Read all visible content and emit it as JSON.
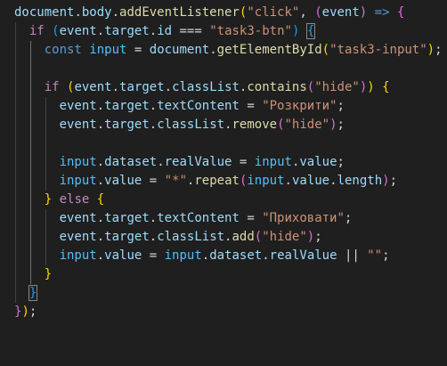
{
  "editor": {
    "language": "javascript",
    "lines": [
      [
        {
          "t": "document",
          "c": "c-var"
        },
        {
          "t": ".",
          "c": "c-op"
        },
        {
          "t": "body",
          "c": "c-var"
        },
        {
          "t": ".",
          "c": "c-op"
        },
        {
          "t": "addEventListener",
          "c": "c-fn"
        },
        {
          "t": "(",
          "c": "c-p1"
        },
        {
          "t": "\"click\"",
          "c": "c-str"
        },
        {
          "t": ", ",
          "c": "c-op"
        },
        {
          "t": "(",
          "c": "c-p2"
        },
        {
          "t": "event",
          "c": "c-var"
        },
        {
          "t": ")",
          "c": "c-p2"
        },
        {
          "t": " ",
          "c": "c-op"
        },
        {
          "t": "=>",
          "c": "c-decl"
        },
        {
          "t": " ",
          "c": "c-op"
        },
        {
          "t": "{",
          "c": "c-p2"
        }
      ],
      [
        {
          "t": "  ",
          "c": "c-op"
        },
        {
          "t": "if",
          "c": "c-kw"
        },
        {
          "t": " ",
          "c": "c-op"
        },
        {
          "t": "(",
          "c": "c-p3"
        },
        {
          "t": "event",
          "c": "c-var"
        },
        {
          "t": ".",
          "c": "c-op"
        },
        {
          "t": "target",
          "c": "c-var"
        },
        {
          "t": ".",
          "c": "c-op"
        },
        {
          "t": "id",
          "c": "c-var"
        },
        {
          "t": " === ",
          "c": "c-op"
        },
        {
          "t": "\"task3-btn\"",
          "c": "c-str"
        },
        {
          "t": ")",
          "c": "c-p3"
        },
        {
          "t": " ",
          "c": "c-op"
        },
        {
          "t": "{",
          "c": "c-p3",
          "m": true
        }
      ],
      [
        {
          "t": "    ",
          "c": "c-op"
        },
        {
          "t": "const",
          "c": "c-decl"
        },
        {
          "t": " ",
          "c": "c-op"
        },
        {
          "t": "input",
          "c": "c-const"
        },
        {
          "t": " = ",
          "c": "c-op"
        },
        {
          "t": "document",
          "c": "c-var"
        },
        {
          "t": ".",
          "c": "c-op"
        },
        {
          "t": "getElementById",
          "c": "c-fn"
        },
        {
          "t": "(",
          "c": "c-p1"
        },
        {
          "t": "\"task3-input\"",
          "c": "c-str"
        },
        {
          "t": ")",
          "c": "c-p1"
        },
        {
          "t": ";",
          "c": "c-op"
        }
      ],
      [],
      [
        {
          "t": "    ",
          "c": "c-op"
        },
        {
          "t": "if",
          "c": "c-kw"
        },
        {
          "t": " ",
          "c": "c-op"
        },
        {
          "t": "(",
          "c": "c-p1"
        },
        {
          "t": "event",
          "c": "c-var"
        },
        {
          "t": ".",
          "c": "c-op"
        },
        {
          "t": "target",
          "c": "c-var"
        },
        {
          "t": ".",
          "c": "c-op"
        },
        {
          "t": "classList",
          "c": "c-var"
        },
        {
          "t": ".",
          "c": "c-op"
        },
        {
          "t": "contains",
          "c": "c-fn"
        },
        {
          "t": "(",
          "c": "c-p2"
        },
        {
          "t": "\"hide\"",
          "c": "c-str"
        },
        {
          "t": ")",
          "c": "c-p2"
        },
        {
          "t": ")",
          "c": "c-p1"
        },
        {
          "t": " ",
          "c": "c-op"
        },
        {
          "t": "{",
          "c": "c-p1"
        }
      ],
      [
        {
          "t": "      ",
          "c": "c-op"
        },
        {
          "t": "event",
          "c": "c-var"
        },
        {
          "t": ".",
          "c": "c-op"
        },
        {
          "t": "target",
          "c": "c-var"
        },
        {
          "t": ".",
          "c": "c-op"
        },
        {
          "t": "textContent",
          "c": "c-var"
        },
        {
          "t": " = ",
          "c": "c-op"
        },
        {
          "t": "\"Розкрити\"",
          "c": "c-str"
        },
        {
          "t": ";",
          "c": "c-op"
        }
      ],
      [
        {
          "t": "      ",
          "c": "c-op"
        },
        {
          "t": "event",
          "c": "c-var"
        },
        {
          "t": ".",
          "c": "c-op"
        },
        {
          "t": "target",
          "c": "c-var"
        },
        {
          "t": ".",
          "c": "c-op"
        },
        {
          "t": "classList",
          "c": "c-var"
        },
        {
          "t": ".",
          "c": "c-op"
        },
        {
          "t": "remove",
          "c": "c-fn"
        },
        {
          "t": "(",
          "c": "c-p2"
        },
        {
          "t": "\"hide\"",
          "c": "c-str"
        },
        {
          "t": ")",
          "c": "c-p2"
        },
        {
          "t": ";",
          "c": "c-op"
        }
      ],
      [],
      [
        {
          "t": "      ",
          "c": "c-op"
        },
        {
          "t": "input",
          "c": "c-const"
        },
        {
          "t": ".",
          "c": "c-op"
        },
        {
          "t": "dataset",
          "c": "c-var"
        },
        {
          "t": ".",
          "c": "c-op"
        },
        {
          "t": "realValue",
          "c": "c-var"
        },
        {
          "t": " = ",
          "c": "c-op"
        },
        {
          "t": "input",
          "c": "c-const"
        },
        {
          "t": ".",
          "c": "c-op"
        },
        {
          "t": "value",
          "c": "c-var"
        },
        {
          "t": ";",
          "c": "c-op"
        }
      ],
      [
        {
          "t": "      ",
          "c": "c-op"
        },
        {
          "t": "input",
          "c": "c-const"
        },
        {
          "t": ".",
          "c": "c-op"
        },
        {
          "t": "value",
          "c": "c-var"
        },
        {
          "t": " = ",
          "c": "c-op"
        },
        {
          "t": "\"*\"",
          "c": "c-str"
        },
        {
          "t": ".",
          "c": "c-op"
        },
        {
          "t": "repeat",
          "c": "c-fn"
        },
        {
          "t": "(",
          "c": "c-p2"
        },
        {
          "t": "input",
          "c": "c-const"
        },
        {
          "t": ".",
          "c": "c-op"
        },
        {
          "t": "value",
          "c": "c-var"
        },
        {
          "t": ".",
          "c": "c-op"
        },
        {
          "t": "length",
          "c": "c-var"
        },
        {
          "t": ")",
          "c": "c-p2"
        },
        {
          "t": ";",
          "c": "c-op"
        }
      ],
      [
        {
          "t": "    ",
          "c": "c-op"
        },
        {
          "t": "}",
          "c": "c-p1"
        },
        {
          "t": " ",
          "c": "c-op"
        },
        {
          "t": "else",
          "c": "c-kw"
        },
        {
          "t": " ",
          "c": "c-op"
        },
        {
          "t": "{",
          "c": "c-p1"
        }
      ],
      [
        {
          "t": "      ",
          "c": "c-op"
        },
        {
          "t": "event",
          "c": "c-var"
        },
        {
          "t": ".",
          "c": "c-op"
        },
        {
          "t": "target",
          "c": "c-var"
        },
        {
          "t": ".",
          "c": "c-op"
        },
        {
          "t": "textContent",
          "c": "c-var"
        },
        {
          "t": " = ",
          "c": "c-op"
        },
        {
          "t": "\"Приховати\"",
          "c": "c-str"
        },
        {
          "t": ";",
          "c": "c-op"
        }
      ],
      [
        {
          "t": "      ",
          "c": "c-op"
        },
        {
          "t": "event",
          "c": "c-var"
        },
        {
          "t": ".",
          "c": "c-op"
        },
        {
          "t": "target",
          "c": "c-var"
        },
        {
          "t": ".",
          "c": "c-op"
        },
        {
          "t": "classList",
          "c": "c-var"
        },
        {
          "t": ".",
          "c": "c-op"
        },
        {
          "t": "add",
          "c": "c-fn"
        },
        {
          "t": "(",
          "c": "c-p2"
        },
        {
          "t": "\"hide\"",
          "c": "c-str"
        },
        {
          "t": ")",
          "c": "c-p2"
        },
        {
          "t": ";",
          "c": "c-op"
        }
      ],
      [
        {
          "t": "      ",
          "c": "c-op"
        },
        {
          "t": "input",
          "c": "c-const"
        },
        {
          "t": ".",
          "c": "c-op"
        },
        {
          "t": "value",
          "c": "c-var"
        },
        {
          "t": " = ",
          "c": "c-op"
        },
        {
          "t": "input",
          "c": "c-const"
        },
        {
          "t": ".",
          "c": "c-op"
        },
        {
          "t": "dataset",
          "c": "c-var"
        },
        {
          "t": ".",
          "c": "c-op"
        },
        {
          "t": "realValue",
          "c": "c-var"
        },
        {
          "t": " || ",
          "c": "c-op"
        },
        {
          "t": "\"\"",
          "c": "c-str"
        },
        {
          "t": ";",
          "c": "c-op"
        }
      ],
      [
        {
          "t": "    ",
          "c": "c-op"
        },
        {
          "t": "}",
          "c": "c-p1"
        }
      ],
      [
        {
          "t": "  ",
          "c": "c-op"
        },
        {
          "t": "}",
          "c": "c-p3",
          "m": true
        }
      ],
      [
        {
          "t": "}",
          "c": "c-p2"
        },
        {
          "t": ")",
          "c": "c-p1"
        },
        {
          "t": ";",
          "c": "c-op"
        }
      ]
    ]
  }
}
